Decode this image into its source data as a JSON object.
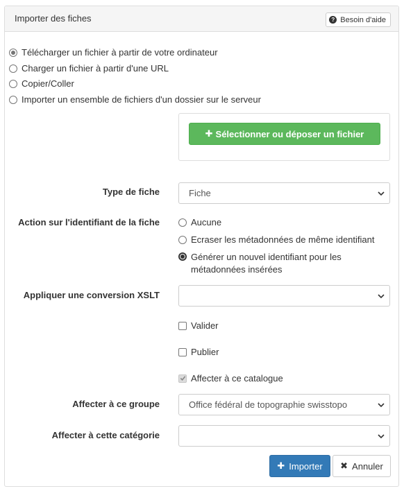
{
  "panel": {
    "title": "Importer des fiches",
    "help_label": "Besoin d'aide"
  },
  "source_options": [
    {
      "label": "Télécharger un fichier à partir de votre ordinateur",
      "checked": true
    },
    {
      "label": "Charger un fichier à partir d'une URL",
      "checked": false
    },
    {
      "label": "Copier/Coller",
      "checked": false
    },
    {
      "label": "Importer un ensemble de fichiers d'un dossier sur le serveur",
      "checked": false
    }
  ],
  "upload": {
    "button_label": "Sélectionner ou déposer un fichier"
  },
  "record_type": {
    "label": "Type de fiche",
    "value": "Fiche"
  },
  "identifier_action": {
    "label": "Action sur l'identifiant de la fiche",
    "options": [
      {
        "label": "Aucune",
        "checked": false
      },
      {
        "label": "Ecraser les métadonnées de même identifiant",
        "checked": false
      },
      {
        "label_line1": "Générer un nouvel identifiant pour les",
        "label_line2": "métadonnées insérées",
        "checked": true
      }
    ]
  },
  "xslt": {
    "label": "Appliquer une conversion XSLT",
    "value": ""
  },
  "checkboxes": {
    "validate": "Valider",
    "publish": "Publier",
    "assign_catalog": "Affecter à ce catalogue"
  },
  "group": {
    "label": "Affecter à ce groupe",
    "value": "Office fédéral de topographie swisstopo"
  },
  "category": {
    "label": "Affecter à cette catégorie",
    "value": ""
  },
  "actions": {
    "import_label": "Importer",
    "cancel_label": "Annuler"
  },
  "colors": {
    "success": "#5cb85c",
    "primary": "#337ab7",
    "border": "#dddddd"
  }
}
